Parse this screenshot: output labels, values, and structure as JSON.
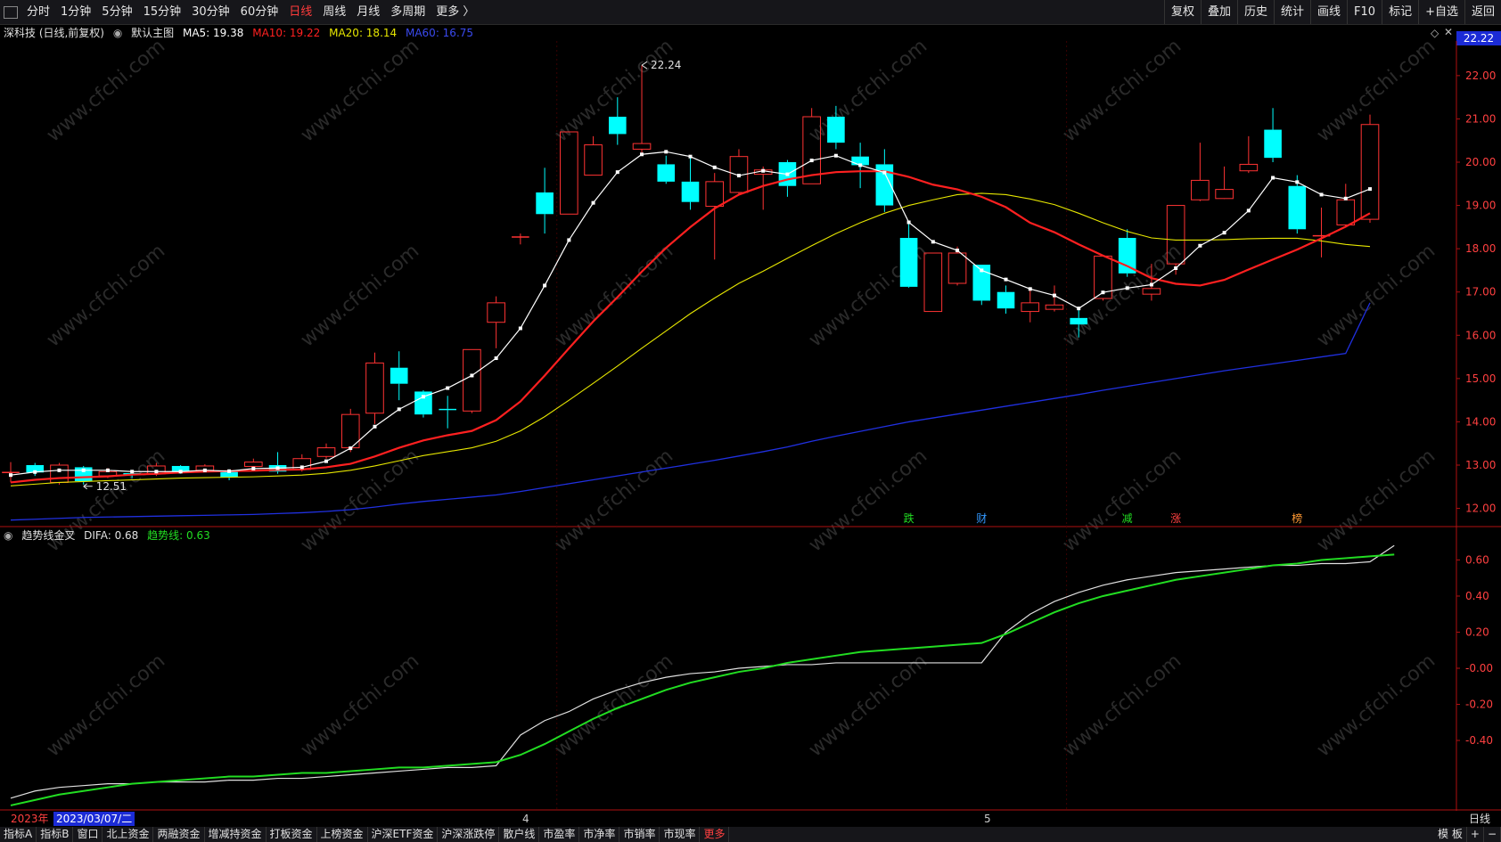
{
  "toolbar": {
    "periods": [
      "分时",
      "1分钟",
      "5分钟",
      "15分钟",
      "30分钟",
      "60分钟",
      "日线",
      "周线",
      "月线",
      "多周期",
      "更多 〉"
    ],
    "active_period": "日线",
    "right_buttons": [
      "复权",
      "叠加",
      "历史",
      "统计",
      "画线",
      "F10",
      "标记",
      "+自选",
      "返回"
    ]
  },
  "stock": {
    "name_label": "深科技 (日线,前复权)",
    "template_label": "默认主图",
    "ma5": "MA5: 19.38",
    "ma10": "MA10: 19.22",
    "ma20": "MA20: 18.14",
    "ma60": "MA60: 16.75",
    "current_price": "22.22"
  },
  "indicator": {
    "name": "趋势线金叉",
    "difa": "DIFA: 0.68",
    "trend": "趋势线: 0.63"
  },
  "colors": {
    "up": "#ff3333",
    "down": "#00ffff",
    "ma5": "#ffffff",
    "ma10": "#ff2020",
    "ma20": "#e6e600",
    "ma60": "#2030e0",
    "difa": "#e0e0e0",
    "trend": "#22dd22"
  },
  "chart_data": {
    "type": "candlestick",
    "price_axis": {
      "ticks": [
        "22.00",
        "21.00",
        "20.00",
        "19.00",
        "18.00",
        "17.00",
        "16.00",
        "15.00",
        "14.00",
        "13.00",
        "12.00"
      ],
      "ylim": [
        11.6,
        22.8
      ]
    },
    "indicator_axis": {
      "ticks": [
        "0.60",
        "0.40",
        "0.20",
        "-0.00",
        "-0.20",
        "-0.40"
      ],
      "ylim": [
        -0.78,
        0.78
      ]
    },
    "annotations": {
      "high": "22.24",
      "low": "12.51"
    },
    "event_markers": [
      "跌",
      "财",
      "减",
      "涨",
      "榜"
    ],
    "event_marker_colors": [
      "#22dd22",
      "#3399ff",
      "#22dd22",
      "#ff4040",
      "#ff9933"
    ],
    "candles": [
      [
        12.83,
        12.83,
        13.07,
        12.6
      ],
      [
        13.0,
        12.83,
        13.05,
        12.75
      ],
      [
        12.6,
        13.0,
        13.05,
        12.55
      ],
      [
        12.95,
        12.63,
        12.98,
        12.55
      ],
      [
        12.75,
        12.85,
        12.93,
        12.7
      ],
      [
        12.8,
        12.78,
        12.84,
        12.7
      ],
      [
        12.8,
        12.98,
        13.05,
        12.75
      ],
      [
        12.98,
        12.85,
        13.0,
        12.8
      ],
      [
        12.88,
        12.98,
        13.02,
        12.85
      ],
      [
        12.87,
        12.72,
        12.9,
        12.65
      ],
      [
        12.97,
        13.07,
        13.15,
        12.92
      ],
      [
        13.0,
        12.85,
        13.3,
        12.8
      ],
      [
        12.9,
        13.15,
        13.25,
        12.85
      ],
      [
        13.2,
        13.4,
        13.5,
        13.15
      ],
      [
        13.4,
        14.17,
        14.3,
        13.3
      ],
      [
        14.2,
        15.36,
        15.6,
        13.95
      ],
      [
        15.25,
        14.88,
        15.63,
        14.5
      ],
      [
        14.7,
        14.17,
        14.73,
        14.1
      ],
      [
        14.3,
        14.27,
        14.6,
        13.85
      ],
      [
        14.25,
        15.67,
        15.67,
        14.2
      ],
      [
        16.3,
        16.75,
        16.9,
        15.7
      ],
      [
        18.27,
        18.27,
        18.35,
        18.1
      ],
      [
        19.3,
        18.8,
        19.87,
        18.35
      ],
      [
        18.8,
        20.7,
        20.7,
        18.8
      ],
      [
        19.7,
        20.4,
        20.6,
        19.7
      ],
      [
        21.05,
        20.65,
        21.5,
        20.4
      ],
      [
        20.3,
        20.43,
        22.24,
        20.2
      ],
      [
        19.95,
        19.55,
        20.15,
        19.5
      ],
      [
        19.55,
        19.08,
        20.1,
        18.9
      ],
      [
        18.98,
        19.55,
        19.75,
        17.75
      ],
      [
        19.3,
        20.13,
        20.3,
        19.25
      ],
      [
        19.72,
        19.82,
        19.9,
        18.9
      ],
      [
        20.0,
        19.45,
        20.05,
        19.2
      ],
      [
        19.5,
        21.05,
        21.25,
        19.5
      ],
      [
        21.05,
        20.45,
        21.3,
        20.3
      ],
      [
        20.13,
        19.93,
        20.45,
        19.4
      ],
      [
        19.95,
        19.0,
        20.3,
        18.85
      ],
      [
        18.25,
        17.12,
        18.6,
        17.1
      ],
      [
        16.55,
        17.9,
        17.9,
        16.55
      ],
      [
        17.2,
        17.9,
        18.05,
        17.15
      ],
      [
        17.63,
        16.8,
        17.63,
        16.7
      ],
      [
        17.0,
        16.62,
        17.15,
        16.5
      ],
      [
        16.55,
        16.75,
        17.05,
        16.3
      ],
      [
        16.6,
        16.7,
        17.15,
        16.55
      ],
      [
        16.4,
        16.25,
        16.65,
        15.95
      ],
      [
        16.85,
        17.83,
        17.85,
        16.8
      ],
      [
        18.25,
        17.43,
        18.45,
        17.35
      ],
      [
        16.95,
        17.08,
        17.65,
        16.8
      ],
      [
        17.65,
        19.0,
        19.0,
        17.4
      ],
      [
        19.13,
        19.58,
        20.45,
        19.1
      ],
      [
        19.16,
        19.37,
        19.9,
        19.15
      ],
      [
        19.8,
        19.95,
        20.6,
        19.75
      ],
      [
        20.75,
        20.1,
        21.25,
        20.0
      ],
      [
        19.45,
        18.45,
        19.7,
        18.35
      ],
      [
        18.3,
        18.3,
        18.95,
        17.8
      ],
      [
        18.55,
        19.13,
        19.5,
        18.5
      ],
      [
        18.68,
        20.87,
        21.1,
        18.6
      ]
    ],
    "ma5": [
      12.77,
      12.84,
      12.88,
      12.88,
      12.88,
      12.85,
      12.85,
      12.85,
      12.88,
      12.86,
      12.92,
      12.93,
      12.95,
      13.09,
      13.39,
      13.89,
      14.29,
      14.58,
      14.78,
      15.07,
      15.47,
      16.16,
      17.15,
      18.2,
      19.06,
      19.77,
      20.18,
      20.24,
      20.13,
      19.88,
      19.69,
      19.8,
      19.72,
      20.04,
      20.15,
      19.93,
      19.76,
      18.61,
      18.16,
      17.96,
      17.5,
      17.29,
      17.07,
      16.92,
      16.62,
      16.99,
      17.09,
      17.17,
      17.55,
      18.07,
      18.37,
      18.88,
      19.64,
      19.54,
      19.25,
      19.16,
      19.38
    ],
    "ma10": [
      12.6,
      12.66,
      12.7,
      12.72,
      12.74,
      12.78,
      12.8,
      12.83,
      12.85,
      12.86,
      12.87,
      12.89,
      12.9,
      12.95,
      13.03,
      13.2,
      13.4,
      13.57,
      13.69,
      13.79,
      14.04,
      14.47,
      15.07,
      15.7,
      16.32,
      16.88,
      17.47,
      18.02,
      18.5,
      18.93,
      19.25,
      19.45,
      19.6,
      19.7,
      19.77,
      19.79,
      19.79,
      19.66,
      19.48,
      19.37,
      19.2,
      18.96,
      18.6,
      18.38,
      18.1,
      17.84,
      17.6,
      17.32,
      17.19,
      17.15,
      17.28,
      17.52,
      17.75,
      17.98,
      18.24,
      18.51,
      18.82,
      19.22
    ],
    "ma20": [
      12.52,
      12.56,
      12.6,
      12.62,
      12.64,
      12.66,
      12.68,
      12.7,
      12.71,
      12.72,
      12.73,
      12.75,
      12.77,
      12.81,
      12.88,
      12.98,
      13.1,
      13.22,
      13.31,
      13.4,
      13.55,
      13.79,
      14.12,
      14.5,
      14.89,
      15.29,
      15.7,
      16.1,
      16.5,
      16.86,
      17.2,
      17.48,
      17.78,
      18.07,
      18.35,
      18.6,
      18.82,
      19.0,
      19.13,
      19.25,
      19.28,
      19.25,
      19.15,
      19.02,
      18.82,
      18.6,
      18.4,
      18.25,
      18.2,
      18.2,
      18.21,
      18.23,
      18.24,
      18.24,
      18.18,
      18.1,
      18.05,
      18.14
    ],
    "ma60": [
      11.73,
      11.75,
      11.77,
      11.79,
      11.8,
      11.81,
      11.82,
      11.83,
      11.84,
      11.85,
      11.86,
      11.88,
      11.9,
      11.93,
      11.97,
      12.03,
      12.1,
      12.16,
      12.21,
      12.26,
      12.31,
      12.39,
      12.48,
      12.57,
      12.66,
      12.75,
      12.84,
      12.93,
      13.02,
      13.11,
      13.21,
      13.31,
      13.42,
      13.55,
      13.67,
      13.78,
      13.89,
      14.0,
      14.09,
      14.18,
      14.27,
      14.36,
      14.45,
      14.54,
      14.63,
      14.73,
      14.82,
      14.91,
      15.0,
      15.09,
      15.18,
      15.26,
      15.34,
      15.42,
      15.5,
      15.58,
      15.67,
      16.75
    ],
    "difa": [
      -0.72,
      -0.68,
      -0.66,
      -0.65,
      -0.64,
      -0.64,
      -0.63,
      -0.63,
      -0.63,
      -0.62,
      -0.62,
      -0.61,
      -0.61,
      -0.6,
      -0.59,
      -0.58,
      -0.57,
      -0.56,
      -0.55,
      -0.55,
      -0.54,
      -0.37,
      -0.29,
      -0.24,
      -0.17,
      -0.12,
      -0.08,
      -0.05,
      -0.03,
      -0.02,
      0.0,
      0.01,
      0.02,
      0.02,
      0.03,
      0.03,
      0.03,
      0.03,
      0.03,
      0.03,
      0.03,
      0.2,
      0.3,
      0.37,
      0.42,
      0.46,
      0.49,
      0.51,
      0.53,
      0.54,
      0.55,
      0.56,
      0.57,
      0.57,
      0.58,
      0.58,
      0.59,
      0.68
    ],
    "trend": [
      -0.76,
      -0.73,
      -0.7,
      -0.68,
      -0.66,
      -0.64,
      -0.63,
      -0.62,
      -0.61,
      -0.6,
      -0.6,
      -0.59,
      -0.58,
      -0.58,
      -0.57,
      -0.56,
      -0.55,
      -0.55,
      -0.54,
      -0.53,
      -0.52,
      -0.48,
      -0.42,
      -0.35,
      -0.28,
      -0.22,
      -0.17,
      -0.12,
      -0.08,
      -0.05,
      -0.02,
      0.0,
      0.03,
      0.05,
      0.07,
      0.09,
      0.1,
      0.11,
      0.12,
      0.13,
      0.14,
      0.19,
      0.25,
      0.31,
      0.36,
      0.4,
      0.43,
      0.46,
      0.49,
      0.51,
      0.53,
      0.55,
      0.57,
      0.58,
      0.6,
      0.61,
      0.62,
      0.63
    ]
  },
  "date_axis": {
    "year_label": "2023年",
    "cursor_date": "2023/03/07/二",
    "month_marks": [
      "4",
      "5"
    ],
    "period_label": "日线"
  },
  "bottom_tabs": [
    "指标A",
    "指标B",
    "窗口",
    "北上资金",
    "两融资金",
    "增减持资金",
    "打板资金",
    "上榜资金",
    "沪深ETF资金",
    "沪深涨跌停",
    "散户线",
    "市盈率",
    "市净率",
    "市销率",
    "市现率",
    "更多"
  ],
  "bottom_right": [
    "模 板",
    "+",
    "−"
  ],
  "watermark": "www.cfchi.com"
}
